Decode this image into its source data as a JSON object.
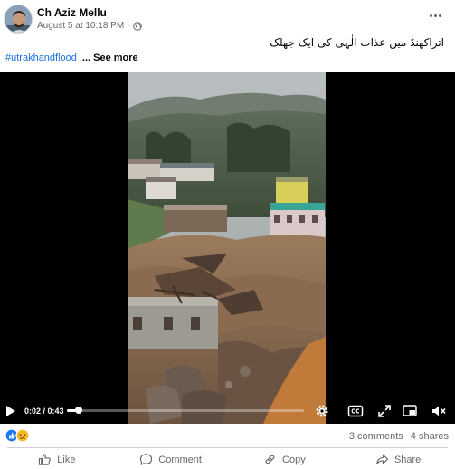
{
  "post": {
    "author": "Ch Aziz Mellu",
    "timestamp": "August 5 at 10:18 PM",
    "separator": "·",
    "caption": "اتراکھنڈ میں عذاب الٰہی کی ایک جھلک",
    "hashtag": "#utrakhandflood",
    "see_more": "... See more"
  },
  "video": {
    "time": "0:02 / 0:43",
    "progress_fraction": 0.05
  },
  "engagement": {
    "comments": "3 comments",
    "shares": "4 shares"
  },
  "actions": {
    "like": "Like",
    "comment": "Comment",
    "copy": "Copy",
    "share": "Share"
  },
  "colors": {
    "hashtag": "#1b6ee0",
    "muted": "#65676b",
    "like_reaction": "#1877f2",
    "sad_reaction": "#f7b928"
  }
}
